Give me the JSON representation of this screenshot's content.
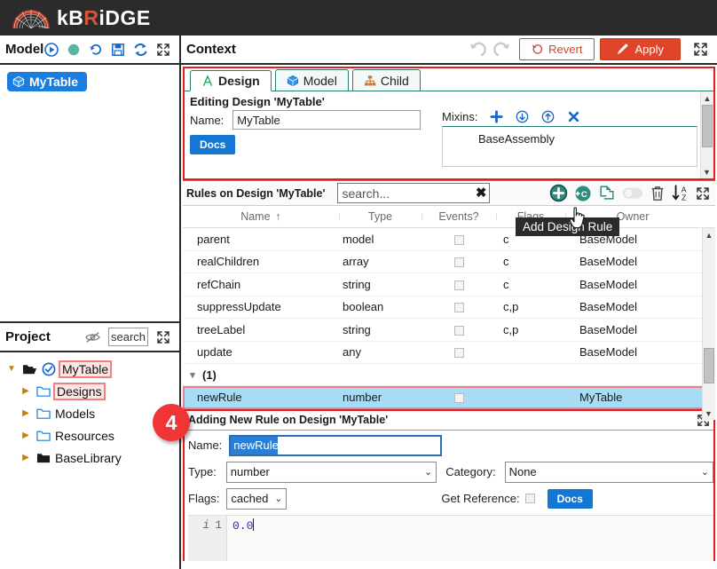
{
  "brand": {
    "name_part1": "kB",
    "name_r": "R",
    "name_part2": "iDGE",
    "logo_icon": "kbridge-arch-logo-icon"
  },
  "model_panel": {
    "title": "Model",
    "icons": [
      "run-icon",
      "status-dot-icon",
      "history-icon",
      "save-icon",
      "refresh-icon",
      "expand-icon"
    ],
    "node_label": "MyTable",
    "node_icon": "cube-icon"
  },
  "project_panel": {
    "title": "Project",
    "visibility_icon": "eye-slash-icon",
    "expand_icon": "expand-icon",
    "search_value": "search",
    "search_placeholder": "search",
    "tree": [
      {
        "label": "MyTable",
        "indent": 0,
        "twisty": "down",
        "icon": "folder-open-icon",
        "check": true,
        "highlight": true
      },
      {
        "label": "Designs",
        "indent": 1,
        "twisty": "right",
        "icon": "folder-icon",
        "check": false,
        "highlight": true
      },
      {
        "label": "Models",
        "indent": 1,
        "twisty": "right",
        "icon": "folder-icon",
        "check": false,
        "highlight": false
      },
      {
        "label": "Resources",
        "indent": 1,
        "twisty": "right",
        "icon": "folder-icon",
        "check": false,
        "highlight": false
      },
      {
        "label": "BaseLibrary",
        "indent": 1,
        "twisty": "right",
        "icon": "folder-solid-icon",
        "check": false,
        "highlight": false
      }
    ]
  },
  "context_header": {
    "title": "Context",
    "undo_icon": "undo-icon",
    "redo_icon": "redo-icon",
    "revert_label": "Revert",
    "revert_icon": "revert-circle-arrow-icon",
    "apply_label": "Apply",
    "apply_icon": "pencil-icon",
    "expand_icon": "expand-icon",
    "apply_color": "#e0452a",
    "revert_color": "#d0472c"
  },
  "design_panel": {
    "tabs": [
      {
        "label": "Design",
        "icon": "compass-a-icon",
        "active": true
      },
      {
        "label": "Model",
        "icon": "cube-icon",
        "active": false
      },
      {
        "label": "Child",
        "icon": "hierarchy-icon",
        "active": false
      }
    ],
    "editing_line": "Editing Design 'MyTable'",
    "name_label": "Name:",
    "name_value": "MyTable",
    "docs_label": "Docs",
    "mixins_label": "Mixins:",
    "mixins_icons": [
      "plus-icon",
      "move-down-icon",
      "move-up-icon",
      "remove-x-icon"
    ],
    "mixins_items": [
      "BaseAssembly"
    ]
  },
  "rules_panel": {
    "title": "Rules on Design 'MyTable'",
    "search_value": "search...",
    "search_placeholder": "search...",
    "search_clear_icon": "clear-x-icon",
    "icons": [
      "add-rule-icon",
      "add-computed-rule-icon",
      "duplicate-icon",
      "toggle-switch-icon",
      "delete-icon",
      "sort-az-icon",
      "expand-icon"
    ],
    "tooltip": "Add Design Rule",
    "columns": [
      "Name",
      "Type",
      "Events?",
      "Flags",
      "Owner"
    ],
    "sort_indicator": "↑",
    "rows": [
      {
        "name": "parent",
        "type": "model",
        "events": false,
        "flags": "c",
        "owner": "BaseModel",
        "selected": false
      },
      {
        "name": "realChildren",
        "type": "array",
        "events": false,
        "flags": "c",
        "owner": "BaseModel",
        "selected": false
      },
      {
        "name": "refChain",
        "type": "string",
        "events": false,
        "flags": "c",
        "owner": "BaseModel",
        "selected": false
      },
      {
        "name": "suppressUpdate",
        "type": "boolean",
        "events": false,
        "flags": "c,p",
        "owner": "BaseModel",
        "selected": false
      },
      {
        "name": "treeLabel",
        "type": "string",
        "events": false,
        "flags": "c,p",
        "owner": "BaseModel",
        "selected": false
      },
      {
        "name": "update",
        "type": "any",
        "events": false,
        "flags": "",
        "owner": "BaseModel",
        "selected": false
      }
    ],
    "group_row": {
      "twisty": "down",
      "label": "(1)"
    },
    "group_rows": [
      {
        "name": "newRule",
        "type": "number",
        "events": false,
        "flags": "",
        "owner": "MyTable",
        "selected": true
      }
    ]
  },
  "add_rule_panel": {
    "title": "Adding New Rule on Design 'MyTable'",
    "expand_icon": "expand-icon",
    "name_label": "Name:",
    "name_value": "newRule",
    "type_label": "Type:",
    "type_value": "number",
    "category_label": "Category:",
    "category_value": "None",
    "flags_label": "Flags:",
    "flags_value": "cached",
    "get_reference_label": "Get Reference:",
    "get_reference_checked": false,
    "docs_label": "Docs",
    "code_gutter_icon": "info-italic-icon",
    "code_line_number": "1",
    "code_text": "0.0"
  },
  "badge": {
    "number": "4",
    "color": "#ef3535"
  }
}
